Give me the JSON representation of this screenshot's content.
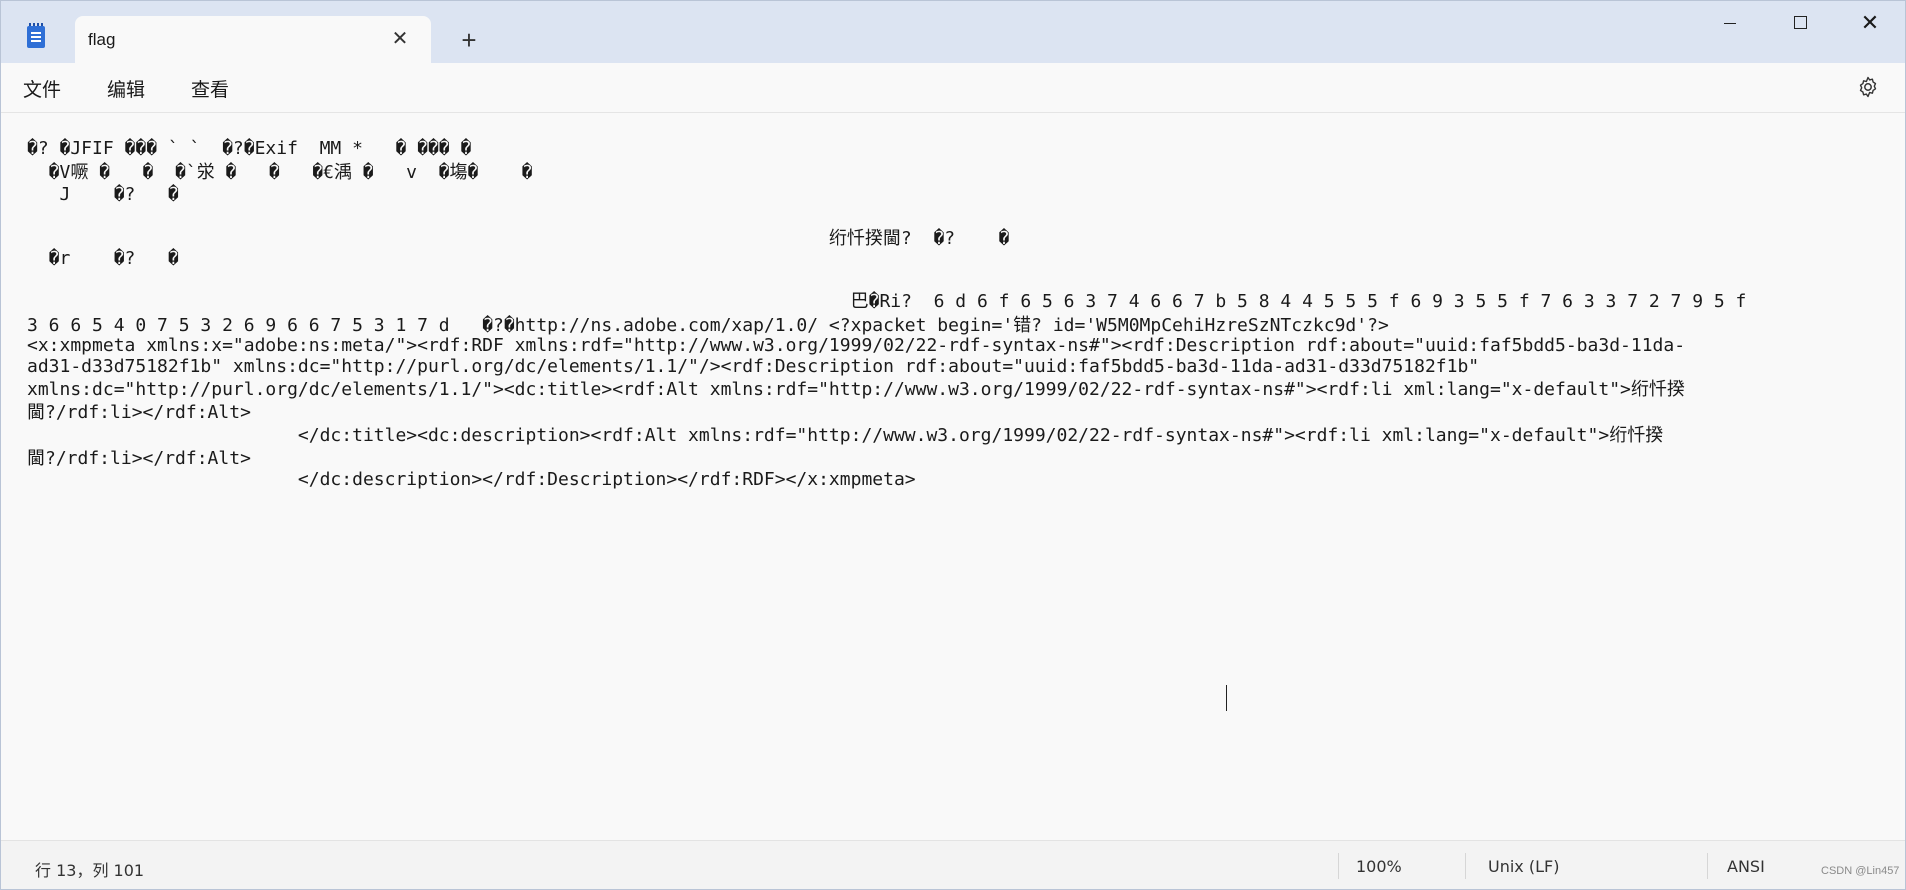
{
  "tab": {
    "title": "flag",
    "close_glyph": "✕",
    "new_tab_glyph": "+"
  },
  "window_controls": {
    "close_glyph": "✕"
  },
  "menu": {
    "file": "文件",
    "edit": "编辑",
    "view": "查看"
  },
  "icons": {
    "app": "notepad-icon",
    "settings": "gear-icon"
  },
  "editor": {
    "lines": [
      "�? �JFIF ��� ` `  �?�Exif  MM *   � ��� �",
      "  �V噘 �   �  �`泶 �   �   �€渪 �   v  �塲�    �",
      "   J    �?   �",
      "                                                                          绗忏揆閫?  �?    �",
      "  �r    �?   �",
      "                                                                            巴�Ri?  6 d 6 f 6 5 6 3 7 4 6 6 7 b 5 8 4 4 5 5 5 f 6 9 3 5 5 f 7 6 3 3 7 2 7 9 5 f",
      "3 6 6 5 4 0 7 5 3 2 6 9 6 6 7 5 3 1 7 d   �?�http://ns.adobe.com/xap/1.0/ <?xpacket begin='错? id='W5M0MpCehiHzreSzNTczkc9d'?>",
      "<x:xmpmeta xmlns:x=\"adobe:ns:meta/\"><rdf:RDF xmlns:rdf=\"http://www.w3.org/1999/02/22-rdf-syntax-ns#\"><rdf:Description rdf:about=\"uuid:faf5bdd5-ba3d-11da-",
      "ad31-d33d75182f1b\" xmlns:dc=\"http://purl.org/dc/elements/1.1/\"/><rdf:Description rdf:about=\"uuid:faf5bdd5-ba3d-11da-ad31-d33d75182f1b\"",
      "xmlns:dc=\"http://purl.org/dc/elements/1.1/\"><dc:title><rdf:Alt xmlns:rdf=\"http://www.w3.org/1999/02/22-rdf-syntax-ns#\"><rdf:li xml:lang=\"x-default\">绗忏揆",
      "閫?/rdf:li></rdf:Alt>",
      "                         </dc:title><dc:description><rdf:Alt xmlns:rdf=\"http://www.w3.org/1999/02/22-rdf-syntax-ns#\"><rdf:li xml:lang=\"x-default\">绗忏揆",
      "閫?/rdf:li></rdf:Alt>",
      "                         </dc:description></rdf:Description></rdf:RDF></x:xmpmeta>"
    ]
  },
  "status": {
    "position": "行 13，列 101",
    "zoom": "100%",
    "line_ending": "Unix (LF)",
    "encoding": "ANSI",
    "watermark": "CSDN @Lin457"
  }
}
